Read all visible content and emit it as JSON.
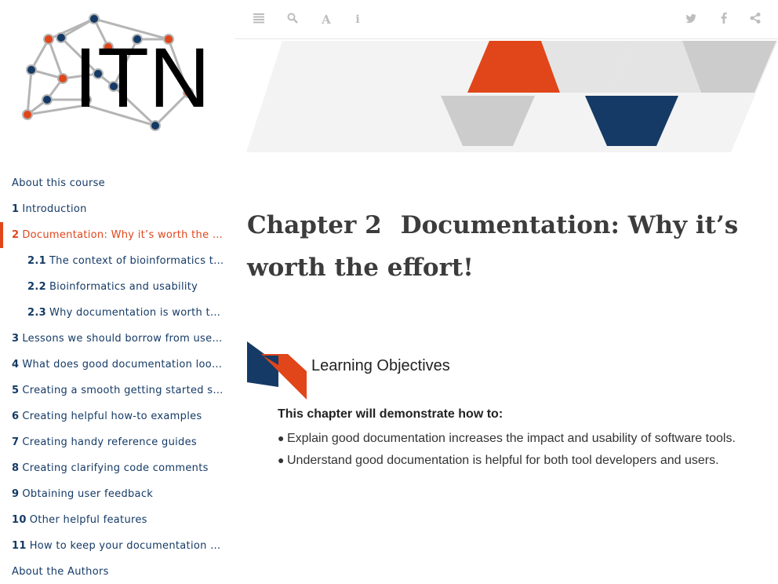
{
  "logo": {
    "text": "ITN"
  },
  "toolbar": {
    "left_icons": [
      "menu-icon",
      "search-icon",
      "font-icon",
      "info-icon"
    ],
    "right_icons": [
      "twitter-icon",
      "facebook-icon",
      "share-icon"
    ]
  },
  "toc": {
    "items": [
      {
        "num": "",
        "label": "About this course",
        "sub": false,
        "active": false
      },
      {
        "num": "1",
        "label": "Introduction",
        "sub": false,
        "active": false
      },
      {
        "num": "2",
        "label": "Documentation: Why it’s worth the effort!",
        "sub": false,
        "active": true
      },
      {
        "num": "2.1",
        "label": "The context of bioinformatics tools",
        "sub": true,
        "active": false
      },
      {
        "num": "2.2",
        "label": "Bioinformatics and usability",
        "sub": true,
        "active": false
      },
      {
        "num": "2.3",
        "label": "Why documentation is worth the effort",
        "sub": true,
        "active": false
      },
      {
        "num": "3",
        "label": "Lessons we should borrow from user design",
        "sub": false,
        "active": false
      },
      {
        "num": "4",
        "label": "What does good documentation look like?",
        "sub": false,
        "active": false
      },
      {
        "num": "5",
        "label": "Creating a smooth getting started section",
        "sub": false,
        "active": false
      },
      {
        "num": "6",
        "label": "Creating helpful how-to examples",
        "sub": false,
        "active": false
      },
      {
        "num": "7",
        "label": "Creating handy reference guides",
        "sub": false,
        "active": false
      },
      {
        "num": "8",
        "label": "Creating clarifying code comments",
        "sub": false,
        "active": false
      },
      {
        "num": "9",
        "label": "Obtaining user feedback",
        "sub": false,
        "active": false
      },
      {
        "num": "10",
        "label": "Other helpful features",
        "sub": false,
        "active": false
      },
      {
        "num": "11",
        "label": "How to keep your documentation up to date",
        "sub": false,
        "active": false
      },
      {
        "num": "",
        "label": "About the Authors",
        "sub": false,
        "active": false
      }
    ]
  },
  "chapter": {
    "num_label": "Chapter 2",
    "title": "Documentation: Why it’s worth the effort!"
  },
  "objectives": {
    "heading": "Learning Objectives",
    "intro": "This chapter will demonstrate how to:",
    "items": [
      "Explain good documentation increases the impact and usability of software tools.",
      "Understand good documentation is helpful for both tool developers and users."
    ]
  },
  "colors": {
    "accent": "#e0461a",
    "navy": "#153a66",
    "gray": "#cccccc"
  }
}
